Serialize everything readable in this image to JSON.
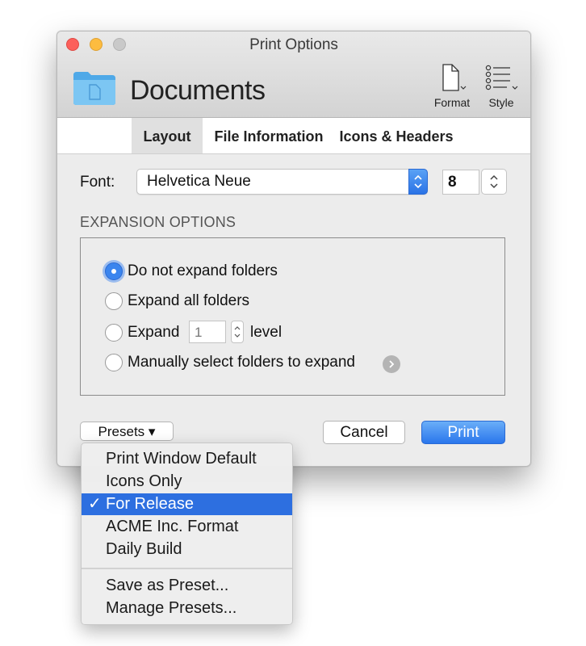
{
  "window": {
    "title": "Print Options"
  },
  "header": {
    "document_name": "Documents",
    "toolbar": {
      "format_label": "Format",
      "style_label": "Style"
    }
  },
  "tabs": [
    {
      "label": "Layout",
      "active": true
    },
    {
      "label": "File Information",
      "active": false
    },
    {
      "label": "Icons & Headers",
      "active": false
    }
  ],
  "font": {
    "label": "Font:",
    "family": "Helvetica Neue",
    "size": "8"
  },
  "expansion": {
    "heading": "EXPANSION OPTIONS",
    "options": [
      {
        "label": "Do not expand folders",
        "selected": true
      },
      {
        "label": "Expand all folders",
        "selected": false
      },
      {
        "label": "Expand",
        "selected": false
      },
      {
        "label": "Manually select folders to expand",
        "selected": false
      }
    ],
    "level_value": "1",
    "level_suffix": "level"
  },
  "buttons": {
    "presets": "Presets ▾",
    "cancel": "Cancel",
    "print": "Print"
  },
  "presets_menu": {
    "check_glyph": "✓",
    "items": [
      {
        "label": "Print Window Default",
        "selected": false
      },
      {
        "label": "Icons Only",
        "selected": false
      },
      {
        "label": "For Release",
        "selected": true
      },
      {
        "label": "ACME Inc. Format",
        "selected": false
      },
      {
        "label": "Daily Build",
        "selected": false
      }
    ],
    "actions": [
      {
        "label": "Save as Preset..."
      },
      {
        "label": "Manage Presets..."
      }
    ]
  },
  "colors": {
    "accent": "#2d6fe0",
    "close": "#fc605b",
    "minimize": "#fdbc40",
    "maximize": "#c9c9c9",
    "folder": "#64b8ee"
  }
}
